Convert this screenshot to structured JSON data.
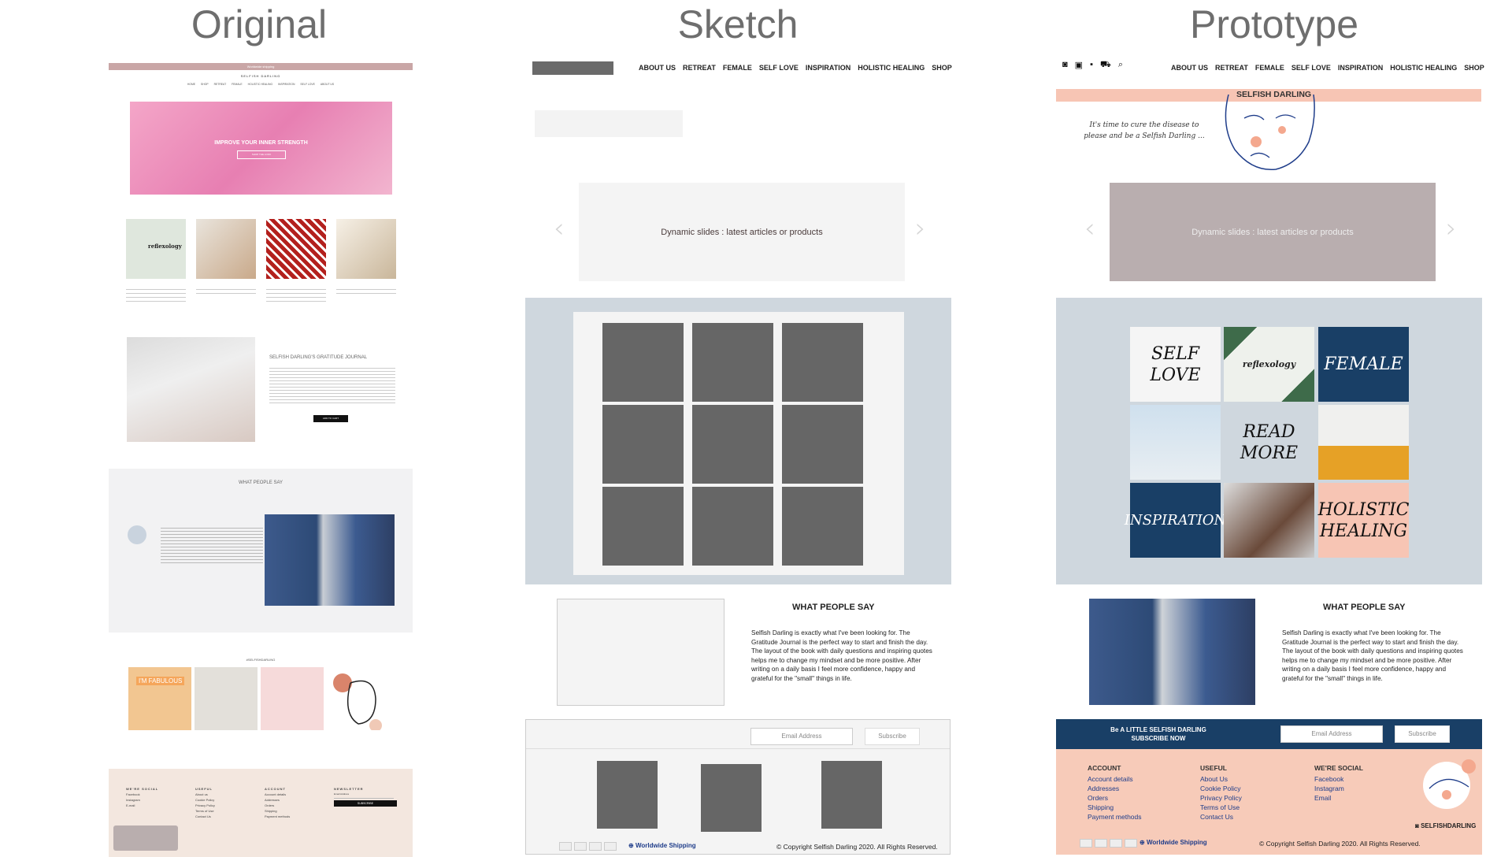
{
  "headers": {
    "original": "Original",
    "sketch": "Sketch",
    "prototype": "Prototype"
  },
  "original": {
    "shipping_bar": "Worldwide shipping",
    "brand": "SELFISH DARLING",
    "nav": [
      "HOME",
      "SHOP",
      "RETREAT",
      "FEMALE",
      "HOLISTIC HEALING",
      "INSPIRATION",
      "SELF LOVE",
      "ABOUT US"
    ],
    "hero_text": "IMPROVE YOUR INNER STRENGTH",
    "hero_button": "SHOP THE LOOK",
    "thumb_reflexology": "reflexology",
    "journal_title": "SELFISH DARLING'S GRATITUDE JOURNAL",
    "journal_button": "ADD TO CART",
    "wps_title": "WHAT PEOPLE SAY",
    "insta_title": "#SELFISHDARLING",
    "fabulous": "I'M FABULOUS",
    "footer": {
      "social_title": "WE'RE SOCIAL",
      "social": [
        "Facebook",
        "Instagram",
        "E-mail"
      ],
      "useful_title": "USEFUL",
      "useful": [
        "About us",
        "Cookie Policy",
        "Privacy Policy",
        "Terms of Use",
        "Contact Us"
      ],
      "account_title": "ACCOUNT",
      "account": [
        "Account details",
        "Addresses",
        "Orders",
        "Shipping",
        "Payment methods"
      ],
      "newsletter_title": "NEWSLETTER",
      "newsletter_placeholder": "Email Address",
      "newsletter_button": "SUBSCRIBE"
    }
  },
  "sketch": {
    "nav": [
      "ABOUT US",
      "RETREAT",
      "FEMALE",
      "SELF LOVE",
      "INSPIRATION",
      "HOLISTIC HEALING",
      "SHOP"
    ],
    "slides_text": "Dynamic slides : latest articles or products",
    "wps_title": "WHAT PEOPLE SAY",
    "wps_text": "Selfish Darling is exactly what I've been looking for. The Gratitude Journal is the perfect way to start and finish the day. The layout of the book with daily questions and inspiring quotes helps me to change my mindset and be more positive. After writing on a daily basis I feel more confidence, happy and grateful for the \"small\" things in life.",
    "email_placeholder": "Email Address",
    "subscribe": "Subscribe",
    "shipping": "Worldwide Shipping",
    "copyright": "© Copyright Selfish Darling 2020. All Rights Reserved."
  },
  "prototype": {
    "icons": [
      "instagram-icon",
      "facebook-icon",
      "account-icon",
      "cart-icon",
      "search-icon"
    ],
    "nav": [
      "ABOUT US",
      "RETREAT",
      "FEMALE",
      "SELF LOVE",
      "INSPIRATION",
      "HOLISTIC HEALING",
      "SHOP"
    ],
    "brand": "SELFISH DARLING",
    "quote": "It's time to cure the disease to please and be a Selfish Darling ...",
    "slides_text": "Dynamic slides : latest articles or products",
    "tiles": {
      "self_love_1": "SELF",
      "self_love_2": "LOVE",
      "reflexology": "reflexology",
      "female": "FEMALE",
      "read_1": "READ",
      "read_2": "MORE",
      "inspiration": "INSPIRATION",
      "holistic_1": "HOLISTIC",
      "holistic_2": "HEALING"
    },
    "wps_title": "WHAT PEOPLE SAY",
    "wps_text": "Selfish Darling is exactly what I've been looking for. The Gratitude Journal is the perfect way to start and finish the day. The layout of the book with daily questions and inspiring quotes helps me to change my mindset and be more positive. After writing on a daily basis I feel more confidence, happy and grateful for the \"small\" things in life.",
    "newsletter_line1": "Be A LITTLE SELFISH DARLING",
    "newsletter_line2": "SUBSCRIBE NOW",
    "email_placeholder": "Email Address",
    "subscribe": "Subscribe",
    "footer": {
      "account_title": "ACCOUNT",
      "account": [
        "Account details",
        "Addresses",
        "Orders",
        "Shipping",
        "Payment methods"
      ],
      "useful_title": "USEFUL",
      "useful": [
        "About Us",
        "Cookie Policy",
        "Privacy Policy",
        "Terms of Use",
        "Contact Us"
      ],
      "social_title": "WE'RE SOCIAL",
      "social": [
        "Facebook",
        "Instagram",
        "Email"
      ],
      "handle": "SELFISHDARLING"
    },
    "shipping": "Worldwide Shipping",
    "copyright": "© Copyright Selfish Darling 2020. All Rights Reserved."
  },
  "colors": {
    "panel": "#cfd7de",
    "peach": "#f7c5b4",
    "navy": "#193f66",
    "slide_proto": "#b9aeaf"
  }
}
